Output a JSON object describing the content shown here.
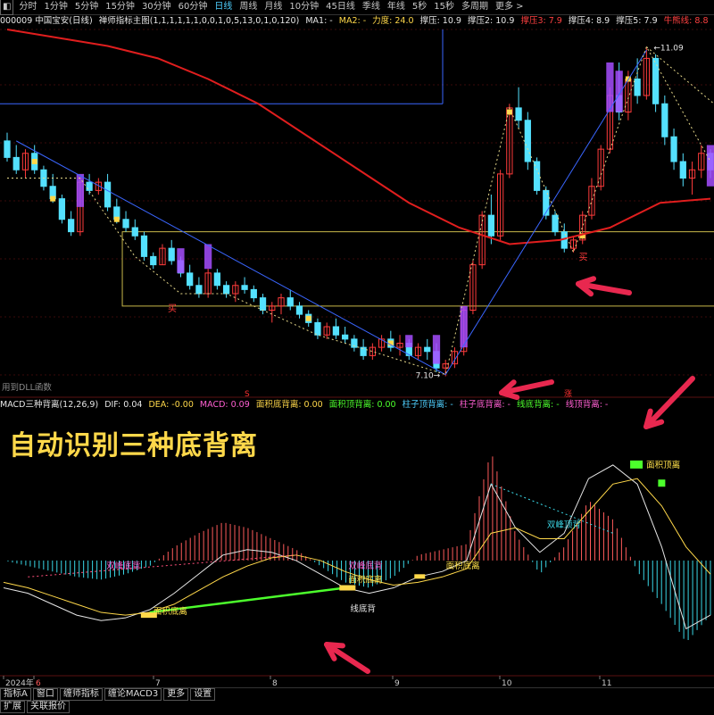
{
  "toolbar": {
    "items": [
      "分时",
      "1分钟",
      "5分钟",
      "15分钟",
      "30分钟",
      "60分钟",
      "日线",
      "周线",
      "月线",
      "10分钟",
      "45日线",
      "季线",
      "年线",
      "5秒",
      "15秒",
      "多周期",
      "更多 >"
    ],
    "active": "日线"
  },
  "info": {
    "stock": "000009 中国宝安(日线)",
    "indicator": "禅师指标主图(1,1,1,1,1,1,0,0,1,0,5,13,0,1,0,120)",
    "ma1": "MA1: -",
    "ma2": "MA2: -",
    "lidu": "力度: 24.0",
    "zc1": "撑压: 10.9",
    "zc2": "撑压2: 10.9",
    "zc3": "撑压3: 7.9",
    "zc4": "撑压4: 8.9",
    "zc5": "撑压5: 7.9",
    "niuxian": "牛熊线: 8.8"
  },
  "colors": {
    "up_candle": "#ff3b3b",
    "down_candle": "#54e1ff",
    "purple": "#a64dff",
    "yellow": "#ffd84a",
    "ma_red": "#e01e1e",
    "blue_line": "#3a66ff",
    "green": "#4cff2c",
    "text_yellow": "#ffe14a",
    "magenta": "#ff5fd2",
    "arrow": "#e8284f"
  },
  "chart_labels": {
    "high_price": "11.09",
    "low_price": "7.10",
    "buy1": "买",
    "buy2": "买",
    "dll": "用到DLL函数",
    "s_mark": "S",
    "zhang": "涨"
  },
  "macd": {
    "title": "MACD三种背离(12,26,9)",
    "dif": "DIF: 0.04",
    "dea": "DEA: -0.00",
    "macd": "MACD: 0.09",
    "mjdbl": "面积底背离: 0.00",
    "mjdbl2": "面积顶背离: 0.00",
    "zzdbl": "柱子顶背离: -",
    "zzdbl2": "柱子底背离: -",
    "xdbl": "线底背离: -",
    "xdbl2": "线顶背离: -",
    "headline": "自动识别三种底背离",
    "ann1": "双峰底背",
    "ann2": "双峰底背",
    "ann3": "面积底离",
    "ann4": "面积底离",
    "ann5": "面积底离",
    "ann6": "线底背",
    "ann7": "双峰顶背",
    "ann8": "面积顶离"
  },
  "xaxis": {
    "labels": [
      "2024年",
      "6",
      "7",
      "8",
      "9",
      "10",
      "11"
    ]
  },
  "bottom": {
    "row1": [
      "指标A",
      "窗口",
      "缠师指标",
      "缠论MACD3",
      "更多",
      "设置"
    ],
    "row2": [
      "扩展",
      "关联报价"
    ]
  },
  "chart_data": [
    {
      "type": "candlestick",
      "title": "禅师指标主图",
      "price_range": [
        6.9,
        11.3
      ],
      "annotations": {
        "high": 11.09,
        "low": 7.1
      },
      "levels": {
        "撑压": 10.9,
        "撑压4": 8.9,
        "撑压3": 7.9,
        "牛熊线": 8.8
      },
      "series": [
        {
          "name": "K线",
          "values": [
            [
              9.95,
              10.05,
              9.7,
              9.75
            ],
            [
              9.75,
              9.9,
              9.55,
              9.6
            ],
            [
              9.6,
              9.85,
              9.5,
              9.8
            ],
            [
              9.8,
              9.9,
              9.55,
              9.6
            ],
            [
              9.6,
              9.65,
              9.35,
              9.4
            ],
            [
              9.4,
              9.55,
              9.2,
              9.25
            ],
            [
              9.25,
              9.3,
              8.95,
              9.0
            ],
            [
              9.0,
              9.1,
              8.8,
              8.85
            ],
            [
              8.85,
              9.5,
              8.8,
              9.45
            ],
            [
              9.45,
              9.55,
              9.3,
              9.35
            ],
            [
              9.35,
              9.5,
              9.3,
              9.45
            ],
            [
              9.45,
              9.55,
              9.1,
              9.15
            ],
            [
              9.15,
              9.25,
              8.95,
              9.0
            ],
            [
              9.0,
              9.1,
              8.85,
              8.9
            ],
            [
              8.9,
              9.0,
              8.75,
              8.8
            ],
            [
              8.8,
              8.85,
              8.5,
              8.55
            ],
            [
              8.55,
              8.6,
              8.4,
              8.45
            ],
            [
              8.45,
              8.7,
              8.45,
              8.65
            ],
            [
              8.65,
              8.75,
              8.45,
              8.5
            ],
            [
              8.5,
              8.55,
              8.3,
              8.35
            ],
            [
              8.35,
              8.45,
              8.15,
              8.2
            ],
            [
              8.2,
              8.3,
              8.05,
              8.1
            ],
            [
              8.1,
              8.4,
              8.05,
              8.35
            ],
            [
              8.35,
              8.4,
              8.15,
              8.2
            ],
            [
              8.2,
              8.25,
              8.05,
              8.1
            ],
            [
              8.1,
              8.25,
              8.0,
              8.2
            ],
            [
              8.2,
              8.3,
              8.1,
              8.15
            ],
            [
              8.15,
              8.2,
              8.0,
              8.05
            ],
            [
              8.05,
              8.1,
              7.85,
              7.9
            ],
            [
              7.9,
              8.0,
              7.75,
              7.95
            ],
            [
              7.95,
              8.1,
              7.85,
              8.05
            ],
            [
              8.05,
              8.15,
              7.9,
              7.95
            ],
            [
              7.95,
              8.0,
              7.8,
              7.85
            ],
            [
              7.85,
              7.9,
              7.7,
              7.75
            ],
            [
              7.75,
              7.8,
              7.55,
              7.6
            ],
            [
              7.6,
              7.75,
              7.55,
              7.7
            ],
            [
              7.7,
              7.8,
              7.55,
              7.6
            ],
            [
              7.6,
              7.7,
              7.5,
              7.55
            ],
            [
              7.55,
              7.6,
              7.4,
              7.45
            ],
            [
              7.45,
              7.55,
              7.3,
              7.35
            ],
            [
              7.35,
              7.5,
              7.3,
              7.45
            ],
            [
              7.45,
              7.6,
              7.4,
              7.55
            ],
            [
              7.55,
              7.65,
              7.4,
              7.45
            ],
            [
              7.45,
              7.6,
              7.35,
              7.5
            ],
            [
              7.5,
              7.55,
              7.3,
              7.35
            ],
            [
              7.35,
              7.5,
              7.3,
              7.45
            ],
            [
              7.45,
              7.55,
              7.3,
              7.4
            ],
            [
              7.4,
              7.5,
              7.15,
              7.2
            ],
            [
              7.2,
              7.3,
              7.1,
              7.25
            ],
            [
              7.25,
              7.45,
              7.2,
              7.4
            ],
            [
              7.4,
              7.95,
              7.35,
              7.9
            ],
            [
              7.9,
              8.5,
              7.85,
              8.45
            ],
            [
              8.45,
              9.1,
              8.4,
              9.05
            ],
            [
              9.05,
              9.3,
              8.7,
              8.8
            ],
            [
              8.8,
              9.6,
              8.75,
              9.55
            ],
            [
              9.55,
              10.4,
              9.5,
              10.35
            ],
            [
              10.35,
              10.6,
              10.1,
              10.2
            ],
            [
              10.2,
              10.3,
              9.6,
              9.7
            ],
            [
              9.7,
              9.75,
              9.3,
              9.35
            ],
            [
              9.35,
              9.4,
              9.0,
              9.05
            ],
            [
              9.05,
              9.1,
              8.8,
              8.85
            ],
            [
              8.85,
              8.95,
              8.6,
              8.65
            ],
            [
              8.65,
              8.8,
              8.6,
              8.75
            ],
            [
              8.75,
              9.1,
              8.7,
              9.05
            ],
            [
              9.05,
              9.5,
              9.0,
              9.4
            ],
            [
              9.4,
              9.9,
              9.35,
              9.85
            ],
            [
              9.85,
              10.6,
              9.8,
              10.5
            ],
            [
              10.5,
              10.9,
              10.2,
              10.3
            ],
            [
              10.3,
              10.8,
              10.2,
              10.7
            ],
            [
              10.7,
              10.95,
              10.4,
              10.5
            ],
            [
              10.5,
              11.09,
              10.45,
              10.95
            ],
            [
              10.95,
              11.0,
              10.3,
              10.4
            ],
            [
              10.4,
              10.5,
              9.9,
              10.0
            ],
            [
              10.0,
              10.1,
              9.6,
              9.7
            ],
            [
              9.7,
              9.8,
              9.4,
              9.5
            ],
            [
              9.5,
              9.7,
              9.3,
              9.6
            ],
            [
              9.6,
              9.9,
              9.5,
              9.8
            ],
            [
              9.8,
              9.85,
              9.5,
              9.6
            ]
          ]
        },
        {
          "name": "MA",
          "values": [
            11.3,
            11.2,
            11.1,
            10.95,
            10.7,
            10.4,
            10.0,
            9.6,
            9.2,
            8.9,
            8.7,
            8.75,
            8.9,
            9.2,
            9.25
          ]
        }
      ]
    },
    {
      "type": "bar",
      "title": "MACD三种背离(12,26,9)",
      "value_range": [
        -0.35,
        0.5
      ],
      "series": [
        {
          "name": "DIF",
          "values": [
            -0.1,
            -0.12,
            -0.16,
            -0.2,
            -0.22,
            -0.21,
            -0.18,
            -0.12,
            -0.05,
            0.02,
            0.04,
            0.03,
            0.0,
            -0.05,
            -0.1,
            -0.12,
            -0.1,
            -0.06,
            -0.04,
            0.0,
            0.28,
            0.12,
            0.03,
            0.1,
            0.3,
            0.35,
            0.28,
            0.05,
            -0.25,
            -0.2
          ]
        },
        {
          "name": "DEA",
          "values": [
            -0.08,
            -0.1,
            -0.13,
            -0.16,
            -0.19,
            -0.2,
            -0.19,
            -0.16,
            -0.11,
            -0.06,
            -0.02,
            0.01,
            0.02,
            0.0,
            -0.04,
            -0.07,
            -0.09,
            -0.08,
            -0.06,
            -0.03,
            0.1,
            0.12,
            0.08,
            0.08,
            0.18,
            0.28,
            0.3,
            0.2,
            0.05,
            -0.05
          ]
        },
        {
          "name": "MACD",
          "values": [
            0.0,
            -0.02,
            -0.04,
            -0.06,
            -0.07,
            -0.05,
            -0.02,
            0.05,
            0.1,
            0.14,
            0.12,
            0.08,
            0.04,
            -0.02,
            -0.08,
            -0.1,
            -0.06,
            0.02,
            0.04,
            0.06,
            0.4,
            0.1,
            -0.05,
            0.05,
            0.22,
            0.15,
            -0.04,
            -0.16,
            -0.3,
            -0.2
          ]
        }
      ]
    }
  ]
}
